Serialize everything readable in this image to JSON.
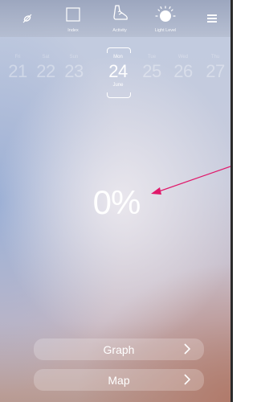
{
  "topbar": {
    "items": [
      {
        "icon": "no-sensor-icon",
        "label": ""
      },
      {
        "icon": "index-square-icon",
        "label": "Index"
      },
      {
        "icon": "shoe-icon",
        "label": "Activity"
      },
      {
        "icon": "sun-icon",
        "label": "Light Level"
      },
      {
        "icon": "menu-icon",
        "label": ""
      }
    ]
  },
  "dates": {
    "days": [
      {
        "name": "Fri",
        "num": "21"
      },
      {
        "name": "Sat",
        "num": "22"
      },
      {
        "name": "Sun",
        "num": "23"
      },
      {
        "name": "Mon",
        "num": "24",
        "month": "June"
      },
      {
        "name": "Tue",
        "num": "25"
      },
      {
        "name": "Wed",
        "num": "26"
      },
      {
        "name": "Thu",
        "num": "27"
      }
    ]
  },
  "main": {
    "percent": "0%"
  },
  "buttons": {
    "graph": "Graph",
    "map": "Map"
  },
  "colors": {
    "arrow": "#e0186a"
  }
}
